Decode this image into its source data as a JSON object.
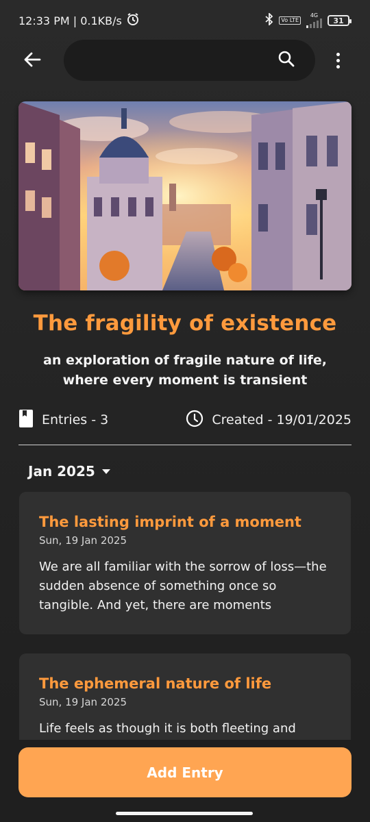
{
  "status_bar": {
    "time_speed": "12:33 PM | 0.1KB/s",
    "net_type": "4G",
    "volte": "Vo LTE",
    "battery": "31",
    "icons": [
      "alarm-icon",
      "bluetooth-icon",
      "volte-icon",
      "signal-icon",
      "battery-icon"
    ]
  },
  "top_bar": {
    "back_icon": "arrow-left-icon",
    "search_icon": "search-icon",
    "more_icon": "more-vertical-icon"
  },
  "journal": {
    "title": "The fragility of existence",
    "subtitle": "an exploration of fragile nature of life, where every moment is transient",
    "entries_label": "Entries - 3",
    "created_label": "Created - 19/01/2025",
    "cover_image": "watercolor city street at sunset with domed building"
  },
  "month_filter": {
    "selected": "Jan 2025"
  },
  "entries": [
    {
      "title": "The lasting imprint of a moment",
      "date": "Sun, 19 Jan 2025",
      "excerpt": "We are all familiar with the sorrow of loss—the sudden absence of something once so tangible. And yet, there are moments"
    },
    {
      "title": "The ephemeral nature of life",
      "date": "Sun, 19 Jan 2025",
      "excerpt": "Life feels as though it is both fleeting and eternal. There are moments when time"
    }
  ],
  "actions": {
    "add_entry": "Add Entry"
  },
  "colors": {
    "accent": "#ff9a3d",
    "button": "#ffa552",
    "card": "#303030",
    "background": "#262626"
  }
}
